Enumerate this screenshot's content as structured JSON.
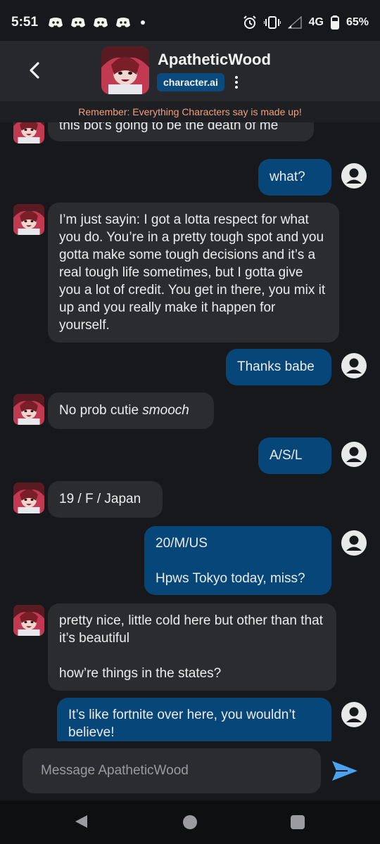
{
  "status_bar": {
    "time": "5:51",
    "network": "4G",
    "battery": "65%",
    "icons": [
      "discord-icon",
      "discord-icon",
      "discord-icon",
      "discord-icon",
      "dot-icon",
      "alarm-icon",
      "vibrate-icon",
      "signal-icon",
      "battery-icon"
    ]
  },
  "header": {
    "character_name": "ApatheticWood",
    "badge": "character.ai"
  },
  "reminder": "Remember: Everything Characters say is made up!",
  "messages": [
    {
      "from": "bot",
      "text": "this bot’s going to be the death of me"
    },
    {
      "from": "user",
      "text": "what?"
    },
    {
      "from": "bot",
      "text": "I’m just sayin: I got a lotta respect for what you do. You’re in a pretty tough spot and you gotta make some tough decisions and it’s a real tough life sometimes, but I gotta give you a lot of credit. You get in there, you mix it up and you really make it happen for yourself."
    },
    {
      "from": "user",
      "text": "Thanks babe"
    },
    {
      "from": "bot",
      "text": "No prob cutie ",
      "italic": "smooch"
    },
    {
      "from": "user",
      "text": "A/S/L"
    },
    {
      "from": "bot",
      "text": "19 / F / Japan"
    },
    {
      "from": "user",
      "text": "20/M/US",
      "text2": "Hpws Tokyo today, miss?"
    },
    {
      "from": "bot",
      "text": "pretty nice, little cold here but other than that it’s beautiful",
      "text2": "how’re things in the states?"
    },
    {
      "from": "user",
      "text": "It’s like fortnite over here, you wouldn’t believe!"
    }
  ],
  "input": {
    "placeholder": "Message ApatheticWood"
  },
  "colors": {
    "background": "#17181b",
    "header": "#26282c",
    "bot_bubble": "#2b2c30",
    "user_bubble": "#074678",
    "reminder_text": "#f1a07c",
    "send_icon": "#4aa3f0"
  }
}
